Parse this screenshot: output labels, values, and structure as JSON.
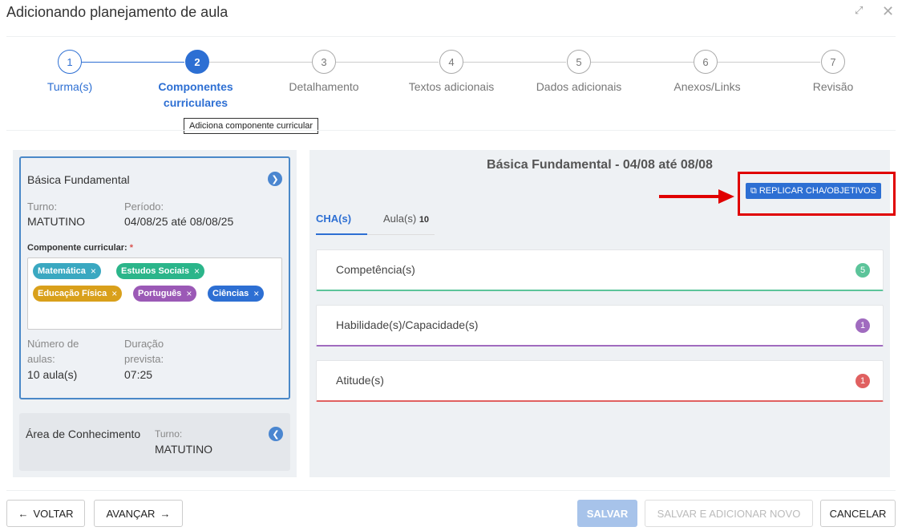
{
  "modal": {
    "title": "Adicionando planejamento de aula"
  },
  "stepper": {
    "steps": [
      {
        "number": "1",
        "label": "Turma(s)",
        "state": "done"
      },
      {
        "number": "2",
        "label": "Componentes curriculares",
        "state": "active"
      },
      {
        "number": "3",
        "label": "Detalhamento",
        "state": "pending"
      },
      {
        "number": "4",
        "label": "Textos adicionais",
        "state": "pending"
      },
      {
        "number": "5",
        "label": "Dados adicionais",
        "state": "pending"
      },
      {
        "number": "6",
        "label": "Anexos/Links",
        "state": "pending"
      },
      {
        "number": "7",
        "label": "Revisão",
        "state": "pending"
      }
    ],
    "step2_label_line1": "Componentes",
    "step2_label_line2": "curriculares"
  },
  "tooltip": {
    "text": "Adiciona componente curricular"
  },
  "left_panel": {
    "selected_card": {
      "title": "Básica Fundamental",
      "turno_label": "Turno:",
      "turno_value": "MATUTINO",
      "periodo_label": "Período:",
      "periodo_value": "04/08/25 até 08/08/25",
      "componente_label": "Componente curricular:",
      "required_mark": "*",
      "tags": [
        {
          "label": "Matemática",
          "color": "#3aa8c1"
        },
        {
          "label": "Estudos Sociais",
          "color": "#2bb58a"
        },
        {
          "label": "Educação Física",
          "color": "#d9a01b"
        },
        {
          "label": "Português",
          "color": "#9b59b6"
        },
        {
          "label": "Ciências",
          "color": "#2d6fd3"
        }
      ],
      "tag_remove": "×",
      "num_aulas_label_1": "Número de",
      "num_aulas_label_2": "aulas:",
      "num_aulas_value": "10 aula(s)",
      "duracao_label_1": "Duração",
      "duracao_label_2": "prevista:",
      "duracao_value": "07:25"
    },
    "other_card": {
      "title": "Área de Conhecimento",
      "turno_label": "Turno:",
      "turno_value": "MATUTINO"
    }
  },
  "right_panel": {
    "title": "Básica Fundamental - 04/08 até 08/08",
    "replicar_button": "REPLICAR CHA/OBJETIVOS",
    "tabs": [
      {
        "label": "CHA(s)"
      },
      {
        "label": "Aula(s)",
        "count": "10"
      }
    ],
    "sections": [
      {
        "title": "Competência(s)",
        "count": "5",
        "color": "#5cc49a"
      },
      {
        "title": "Habilidade(s)/Capacidade(s)",
        "count": "1",
        "color": "#a06bbf"
      },
      {
        "title": "Atitude(s)",
        "count": "1",
        "color": "#e06060"
      }
    ]
  },
  "footer": {
    "voltar": "VOLTAR",
    "avancar": "AVANÇAR",
    "salvar": "SALVAR",
    "salvar_novo": "SALVAR E ADICIONAR NOVO",
    "cancelar": "CANCELAR"
  },
  "colors": {
    "primary": "#2d6fd3",
    "highlight": "#e00000"
  }
}
